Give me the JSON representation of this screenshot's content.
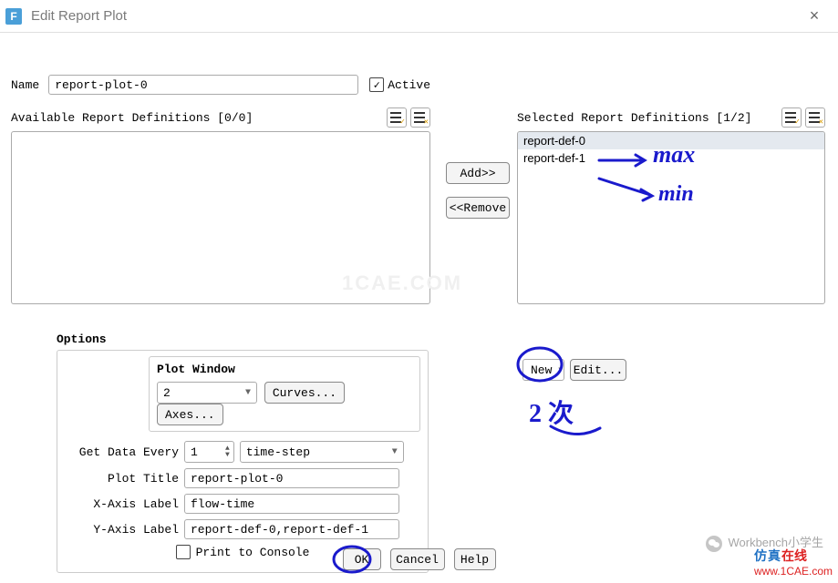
{
  "window": {
    "app_letter": "F",
    "title": "Edit Report Plot"
  },
  "name_label": "Name",
  "name_value": "report-plot-0",
  "active_label": "Active",
  "active_checked": true,
  "available": {
    "header": "Available Report Definitions [0/0]",
    "items": []
  },
  "selected": {
    "header": "Selected Report Definitions [1/2]",
    "items": [
      "report-def-0",
      "report-def-1"
    ]
  },
  "buttons": {
    "add": "Add>>",
    "remove": "<<Remove",
    "new": "New",
    "edit": "Edit...",
    "ok": "OK",
    "cancel": "Cancel",
    "help": "Help",
    "curves": "Curves...",
    "axes": "Axes..."
  },
  "options": {
    "title": "Options",
    "plot_window_label": "Plot Window",
    "plot_window_value": "2",
    "get_data_label": "Get Data Every",
    "get_data_value": "1",
    "timestep_value": "time-step",
    "plot_title_label": "Plot Title",
    "plot_title_value": "report-plot-0",
    "x_axis_label_label": "X-Axis Label",
    "x_axis_label_value": "flow-time",
    "y_axis_label_label": "Y-Axis Label",
    "y_axis_label_value": "report-def-0,report-def-1",
    "print_console_label": "Print to Console",
    "print_console_checked": false
  },
  "annotations": {
    "max": "max",
    "min": "min",
    "two_times": "2 次"
  },
  "watermarks": {
    "center": "1CAE.COM",
    "wechat": "Workbench小学生",
    "brand_cn": "仿真",
    "brand_en": "在线",
    "url": "www.1CAE.com"
  }
}
